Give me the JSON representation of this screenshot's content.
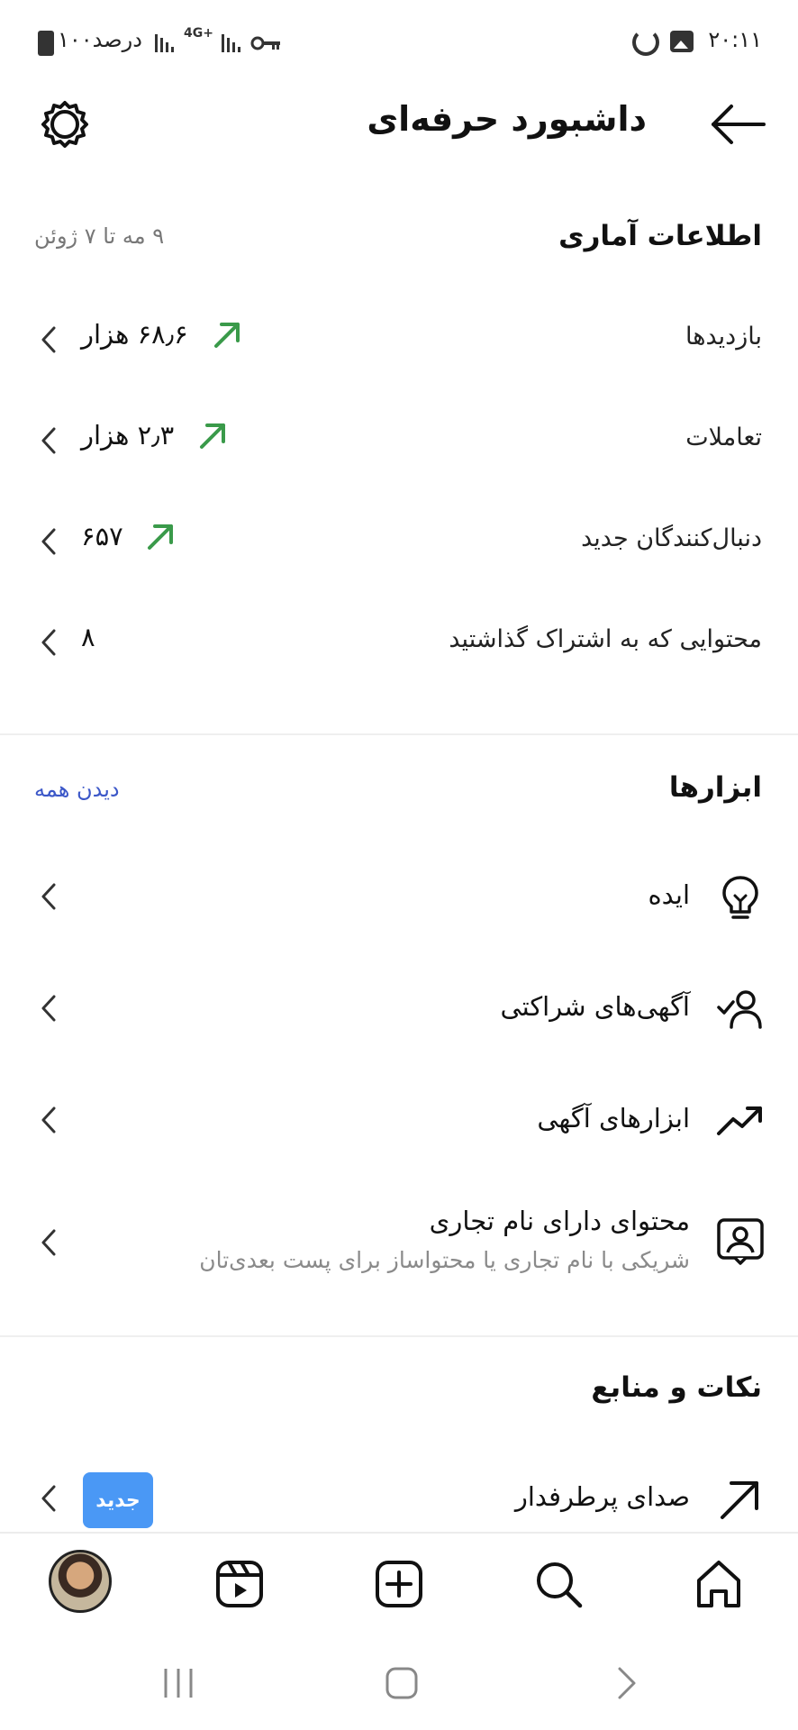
{
  "status_bar": {
    "time": "۲۰:۱۱",
    "battery": "۱۰۰درصد",
    "network": "4G+"
  },
  "header": {
    "title": "داشبورد حرفه‌ای"
  },
  "stats": {
    "title": "اطلاعات آماری",
    "date_range": "۹ مه تا ۷ ژوئن",
    "rows": [
      {
        "label": "بازدیدها",
        "value": "۶۸٫۶ هزار",
        "trend": "up"
      },
      {
        "label": "تعاملات",
        "value": "۲٫۳ هزار",
        "trend": "up"
      },
      {
        "label": "دنبال‌کنندگان جدید",
        "value": "۶۵۷",
        "trend": "up"
      },
      {
        "label": "محتوایی که به اشتراک گذاشتید",
        "value": "۸",
        "trend": "none"
      }
    ]
  },
  "tools": {
    "title": "ابزارها",
    "see_all": "دیدن همه",
    "items": [
      {
        "label": "ایده",
        "icon": "lightbulb-icon"
      },
      {
        "label": "آگهی‌های شراکتی",
        "icon": "person-check-icon"
      },
      {
        "label": "ابزارهای آگهی",
        "icon": "trending-up-icon"
      },
      {
        "label": "محتوای دارای نام تجاری",
        "sub": "شریکی با نام تجاری یا محتواساز برای پست بعدی‌تان",
        "icon": "branded-content-icon"
      }
    ]
  },
  "tips": {
    "title": "نکات و منابع",
    "items": [
      {
        "label": "صدای پرطرفدار",
        "badge": "جدید",
        "icon": "arrow-up-right-icon"
      }
    ]
  },
  "colors": {
    "trend_green": "#3a9a4a",
    "link_blue": "#3b57c8",
    "badge_blue": "#4a98f5"
  }
}
